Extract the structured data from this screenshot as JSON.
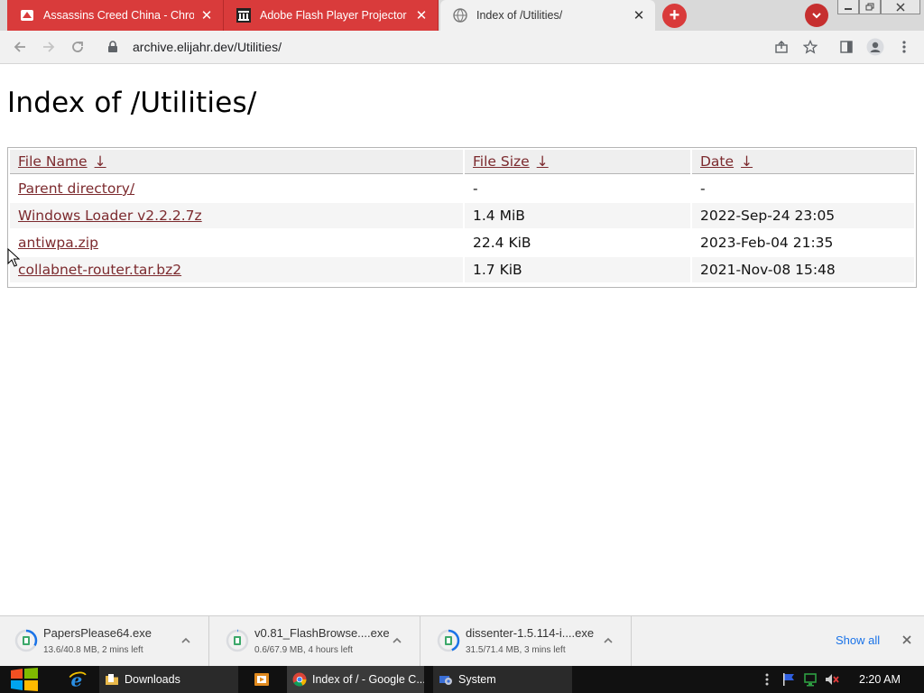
{
  "tabs": [
    {
      "title": "Assassins Creed China - Chrome",
      "icon": "game-favicon"
    },
    {
      "title": "Adobe Flash Player Projector : Ar",
      "icon": "archive-favicon"
    },
    {
      "title": "Index of /Utilities/",
      "icon": "globe-favicon"
    }
  ],
  "address": {
    "url": "archive.elijahr.dev/Utilities/"
  },
  "page": {
    "title": "Index of /Utilities/",
    "headers": {
      "name": "File Name",
      "size": "File Size",
      "date": "Date",
      "sort_arrow": "↓"
    },
    "rows": [
      {
        "name": "Parent directory/",
        "size": "-",
        "date": "-"
      },
      {
        "name": "Windows Loader v2.2.2.7z",
        "size": "1.4 MiB",
        "date": "2022-Sep-24 23:05"
      },
      {
        "name": "antiwpa.zip",
        "size": "22.4 KiB",
        "date": "2023-Feb-04 21:35"
      },
      {
        "name": "collabnet-router.tar.bz2",
        "size": "1.7 KiB",
        "date": "2021-Nov-08 15:48"
      }
    ]
  },
  "downloads": {
    "items": [
      {
        "filename": "PapersPlease64.exe",
        "status": "13.6/40.8 MB, 2 mins left",
        "progress": 0.33
      },
      {
        "filename": "v0.81_FlashBrowse....exe",
        "status": "0.6/67.9 MB, 4 hours left",
        "progress": 0.01
      },
      {
        "filename": "dissenter-1.5.114-i....exe",
        "status": "31.5/71.4 MB, 3 mins left",
        "progress": 0.44
      }
    ],
    "show_all": "Show all"
  },
  "taskbar": {
    "items": [
      {
        "label": "Downloads"
      },
      {
        "label": "Index of / - Google C..."
      },
      {
        "label": "System"
      }
    ],
    "clock": "2:20 AM"
  },
  "colors": {
    "tab_red": "#d93b3b",
    "link": "#7c2a2e",
    "show_all": "#1a73e8",
    "taskbar": "#111111"
  }
}
